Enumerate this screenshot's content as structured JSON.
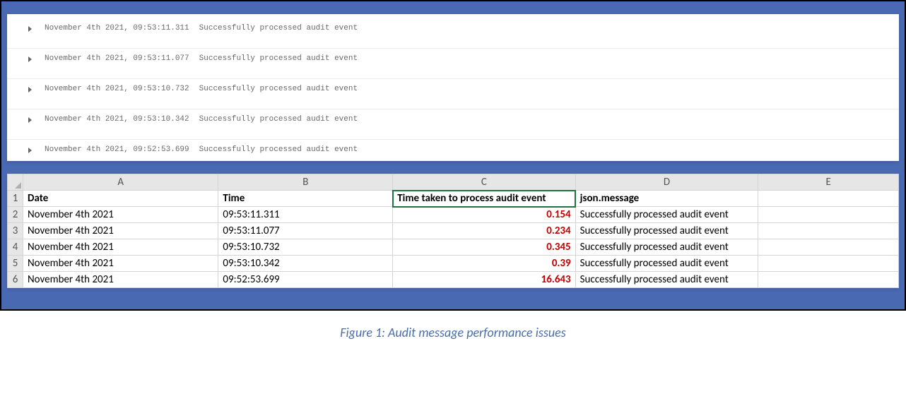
{
  "log_panel": {
    "rows": [
      {
        "timestamp": "November 4th 2021, 09:53:11.311",
        "message": "Successfully processed audit event"
      },
      {
        "timestamp": "November 4th 2021, 09:53:11.077",
        "message": "Successfully processed audit event"
      },
      {
        "timestamp": "November 4th 2021, 09:53:10.732",
        "message": "Successfully processed audit event"
      },
      {
        "timestamp": "November 4th 2021, 09:53:10.342",
        "message": "Successfully processed audit event"
      },
      {
        "timestamp": "November 4th 2021, 09:52:53.699",
        "message": "Successfully processed audit event"
      }
    ]
  },
  "spreadsheet": {
    "columns": [
      "A",
      "B",
      "C",
      "D",
      "E"
    ],
    "headers": {
      "A": "Date",
      "B": "Time",
      "C": "Time taken to process audit event",
      "D": "json.message",
      "E": ""
    },
    "selected_cell": "C1",
    "rows": [
      {
        "num": "2",
        "A": "November 4th 2021",
        "B": "09:53:11.311",
        "C": "0.154",
        "D": "Successfully processed audit event",
        "E": ""
      },
      {
        "num": "3",
        "A": "November 4th 2021",
        "B": "09:53:11.077",
        "C": "0.234",
        "D": "Successfully processed audit event",
        "E": ""
      },
      {
        "num": "4",
        "A": "November 4th 2021",
        "B": "09:53:10.732",
        "C": "0.345",
        "D": "Successfully processed audit event",
        "E": ""
      },
      {
        "num": "5",
        "A": "November 4th 2021",
        "B": "09:53:10.342",
        "C": "0.39",
        "D": "Successfully processed audit event",
        "E": ""
      },
      {
        "num": "6",
        "A": "November 4th 2021",
        "B": "09:52:53.699",
        "C": "16.643",
        "D": "Successfully processed audit event",
        "E": ""
      }
    ]
  },
  "caption": "Figure 1: Audit message performance issues"
}
